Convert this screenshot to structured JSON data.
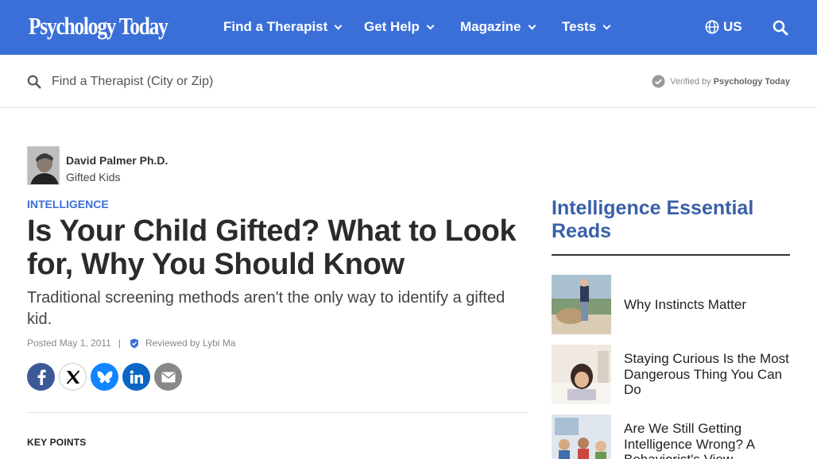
{
  "header": {
    "logo": "Psychology Today",
    "nav": [
      {
        "label": "Find a Therapist"
      },
      {
        "label": "Get Help"
      },
      {
        "label": "Magazine"
      },
      {
        "label": "Tests"
      }
    ],
    "region": "US"
  },
  "search": {
    "placeholder": "Find a Therapist (City or Zip)",
    "verified_prefix": "Verified by",
    "verified_brand": "Psychology Today"
  },
  "author": {
    "name": "David Palmer Ph.D.",
    "blog": "Gifted Kids"
  },
  "article": {
    "category": "INTELLIGENCE",
    "title": "Is Your Child Gifted? What to Look for, Why You Should Know",
    "subtitle": "Traditional screening methods aren't the only way to identify a gifted kid.",
    "posted": "Posted May 1, 2011",
    "separator": "|",
    "reviewed": "Reviewed by Lybi Ma",
    "key_points": "KEY POINTS"
  },
  "share": [
    {
      "name": "facebook",
      "color": "#3b5998"
    },
    {
      "name": "x",
      "color": "#000000"
    },
    {
      "name": "bluesky",
      "color": "#1185fe"
    },
    {
      "name": "linkedin",
      "color": "#0a66c2"
    },
    {
      "name": "email",
      "color": "#888888"
    }
  ],
  "sidebar": {
    "title": "Intelligence Essential Reads",
    "items": [
      {
        "label": "Why Instincts Matter"
      },
      {
        "label": "Staying Curious Is the Most Dangerous Thing You Can Do"
      },
      {
        "label": "Are We Still Getting Intelligence Wrong? A Behaviorist's View"
      }
    ]
  },
  "colors": {
    "brand_blue": "#3a6fd8",
    "sidebar_title": "#3a5fa8"
  }
}
